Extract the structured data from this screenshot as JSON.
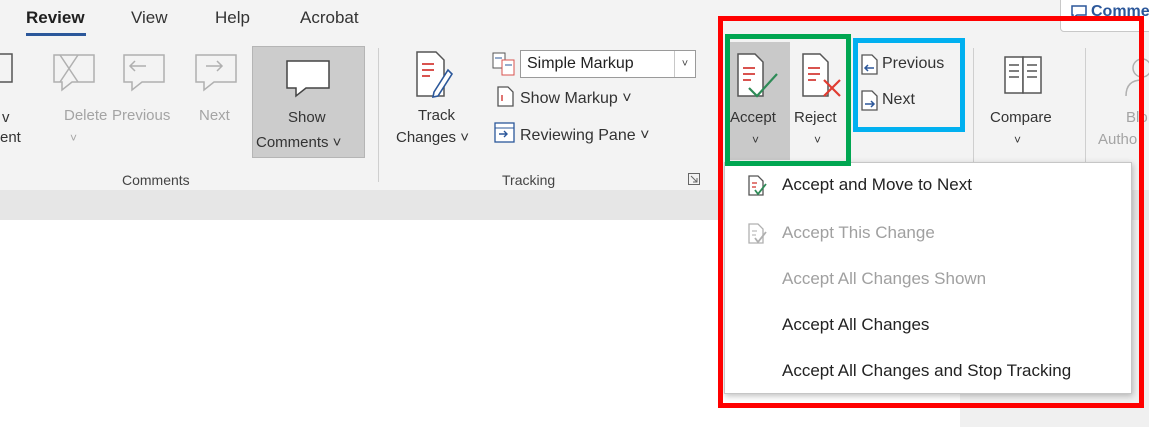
{
  "tabs": [
    "Review",
    "View",
    "Help",
    "Acrobat"
  ],
  "comments_tab": "Comments",
  "ribbon": {
    "comments_group": {
      "label": "Comments",
      "new_label_line2": "ent",
      "new_label_prefix": "v",
      "delete_label": "Delete",
      "previous_label": "Previous",
      "next_label": "Next",
      "show_label_line1": "Show",
      "show_label_line2": "Comments ˅"
    },
    "tracking_group": {
      "label": "Tracking",
      "track_line1": "Track",
      "track_line2": "Changes ˅",
      "markup_select": "Simple Markup",
      "show_markup": "Show Markup ˅",
      "reviewing_pane": "Reviewing Pane  ˅"
    },
    "changes_group": {
      "accept_label": "Accept",
      "reject_label": "Reject",
      "previous_label": "Previous",
      "next_label": "Next"
    },
    "compare_label": "Compare",
    "block_label_line1": "Blo",
    "block_label_line2": "Autho"
  },
  "accept_menu": {
    "items": [
      {
        "label": "Accept and Move to Next",
        "enabled": true
      },
      {
        "label": "Accept This Change",
        "enabled": false
      },
      {
        "label": "Accept All Changes Shown",
        "enabled": false
      },
      {
        "label": "Accept All Changes",
        "enabled": true
      },
      {
        "label": "Accept All Changes and Stop Tracking",
        "enabled": true
      }
    ]
  },
  "highlight_colors": {
    "red": "#ff0000",
    "green": "#00a651",
    "blue": "#00b0f0"
  }
}
